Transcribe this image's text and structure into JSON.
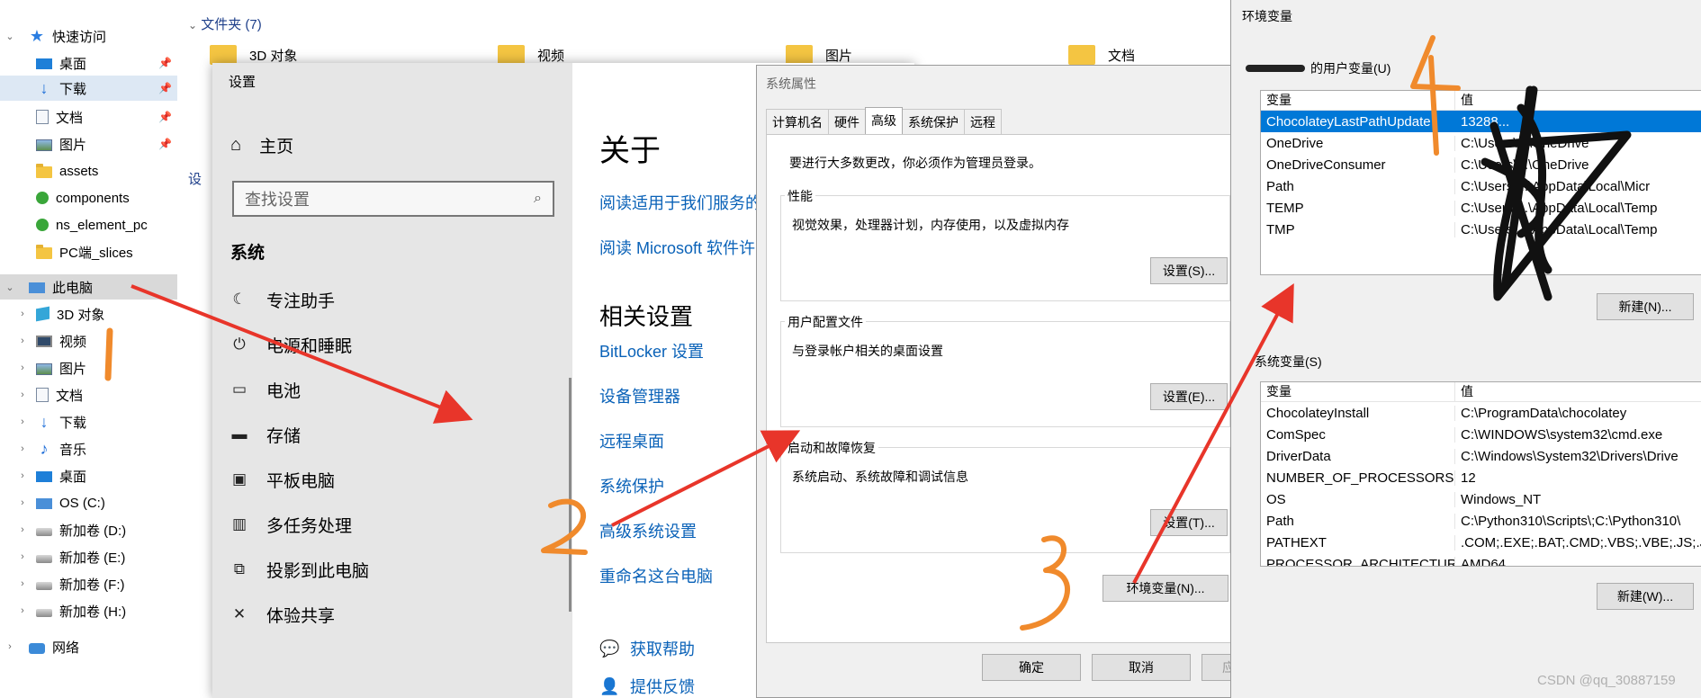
{
  "explorer": {
    "nav": [
      {
        "label": "快速访问",
        "icon": "star-icon",
        "expanded": true
      },
      {
        "label": "桌面",
        "icon": "desktop-icon",
        "pinned": true
      },
      {
        "label": "下载",
        "icon": "download-icon",
        "pinned": true,
        "selected": true
      },
      {
        "label": "文档",
        "icon": "document-icon",
        "pinned": true
      },
      {
        "label": "图片",
        "icon": "picture-icon",
        "pinned": true
      },
      {
        "label": "assets",
        "icon": "folder-icon"
      },
      {
        "label": "components",
        "icon": "green-folder-icon"
      },
      {
        "label": "ns_element_pc",
        "icon": "green-folder-icon"
      },
      {
        "label": "PC端_slices",
        "icon": "folder-icon"
      },
      {
        "label": "此电脑",
        "icon": "computer-icon",
        "expanded": true,
        "highlighted": true
      },
      {
        "label": "3D 对象",
        "icon": "3d-objects-icon"
      },
      {
        "label": "视频",
        "icon": "video-icon"
      },
      {
        "label": "图片",
        "icon": "picture-icon"
      },
      {
        "label": "文档",
        "icon": "document-icon"
      },
      {
        "label": "下载",
        "icon": "download-icon"
      },
      {
        "label": "音乐",
        "icon": "music-icon"
      },
      {
        "label": "桌面",
        "icon": "desktop-icon"
      },
      {
        "label": "OS (C:)",
        "icon": "os-drive-icon"
      },
      {
        "label": "新加卷 (D:)",
        "icon": "drive-icon"
      },
      {
        "label": "新加卷 (E:)",
        "icon": "drive-icon"
      },
      {
        "label": "新加卷 (F:)",
        "icon": "drive-icon"
      },
      {
        "label": "新加卷 (H:)",
        "icon": "drive-icon"
      },
      {
        "label": "网络",
        "icon": "network-icon"
      }
    ],
    "folders_header": "文件夹 (7)",
    "top_folders": [
      "3D 对象",
      "视频",
      "图片",
      "文档"
    ],
    "partial_section_label": "设"
  },
  "settings": {
    "title": "设置",
    "home": "主页",
    "search_placeholder": "查找设置",
    "section": "系统",
    "items": [
      {
        "label": "专注助手",
        "icon": "moon-icon"
      },
      {
        "label": "电源和睡眠",
        "icon": "power-icon"
      },
      {
        "label": "电池",
        "icon": "battery-icon"
      },
      {
        "label": "存储",
        "icon": "storage-icon"
      },
      {
        "label": "平板电脑",
        "icon": "tablet-icon"
      },
      {
        "label": "多任务处理",
        "icon": "multitask-icon"
      },
      {
        "label": "投影到此电脑",
        "icon": "project-icon"
      },
      {
        "label": "体验共享",
        "icon": "share-icon"
      }
    ],
    "about_title": "关于",
    "about_links": [
      "阅读适用于我们服务的",
      "阅读 Microsoft 软件许"
    ],
    "related_title": "相关设置",
    "related_links": [
      "BitLocker 设置",
      "设备管理器",
      "远程桌面",
      "系统保护",
      "高级系统设置",
      "重命名这台电脑"
    ],
    "help_links": [
      "获取帮助",
      "提供反馈"
    ]
  },
  "sysprops": {
    "title": "系统属性",
    "tabs": [
      "计算机名",
      "硬件",
      "高级",
      "系统保护",
      "远程"
    ],
    "active_tab": "高级",
    "note": "要进行大多数更改，你必须作为管理员登录。",
    "groups": [
      {
        "label": "性能",
        "desc": "视觉效果，处理器计划，内存使用，以及虚拟内存",
        "button": "设置(S)..."
      },
      {
        "label": "用户配置文件",
        "desc": "与登录帐户相关的桌面设置",
        "button": "设置(E)..."
      },
      {
        "label": "启动和故障恢复",
        "desc": "系统启动、系统故障和调试信息",
        "button": "设置(T)..."
      }
    ],
    "env_button": "环境变量(N)...",
    "ok": "确定",
    "cancel": "取消",
    "apply_partial": "应"
  },
  "envvars": {
    "title": "环境变量",
    "user_label": "的用户变量(U)",
    "headers": [
      "变量",
      "值"
    ],
    "user_vars": [
      {
        "name": "ChocolateyLastPathUpdate",
        "value": "13288..."
      },
      {
        "name": "OneDrive",
        "value": "C:\\Users\\...\\OneDrive"
      },
      {
        "name": "OneDriveConsumer",
        "value": "C:\\Users\\...\\OneDrive"
      },
      {
        "name": "Path",
        "value": "C:\\Users\\...\\AppData\\Local\\Micr"
      },
      {
        "name": "TEMP",
        "value": "C:\\Users\\...\\AppData\\Local\\Temp"
      },
      {
        "name": "TMP",
        "value": "C:\\Users\\...\\AppData\\Local\\Temp"
      }
    ],
    "user_new": "新建(N)...",
    "system_label": "系统变量(S)",
    "system_vars": [
      {
        "name": "ChocolateyInstall",
        "value": "C:\\ProgramData\\chocolatey"
      },
      {
        "name": "ComSpec",
        "value": "C:\\WINDOWS\\system32\\cmd.exe"
      },
      {
        "name": "DriverData",
        "value": "C:\\Windows\\System32\\Drivers\\Drive"
      },
      {
        "name": "NUMBER_OF_PROCESSORS",
        "value": "12"
      },
      {
        "name": "OS",
        "value": "Windows_NT"
      },
      {
        "name": "Path",
        "value": "C:\\Python310\\Scripts\\;C:\\Python310\\"
      },
      {
        "name": "PATHEXT",
        "value": ".COM;.EXE;.BAT;.CMD;.VBS;.VBE;.JS;.J"
      },
      {
        "name": "PROCESSOR_ARCHITECTURE",
        "value": "AMD64"
      }
    ],
    "system_new": "新建(W)..."
  },
  "annotations": {
    "step_numbers": [
      "2",
      "3",
      "4"
    ],
    "arrow_color": "#e8352a",
    "number_color": "#f08a2c"
  },
  "watermark": "CSDN @qq_30887159"
}
